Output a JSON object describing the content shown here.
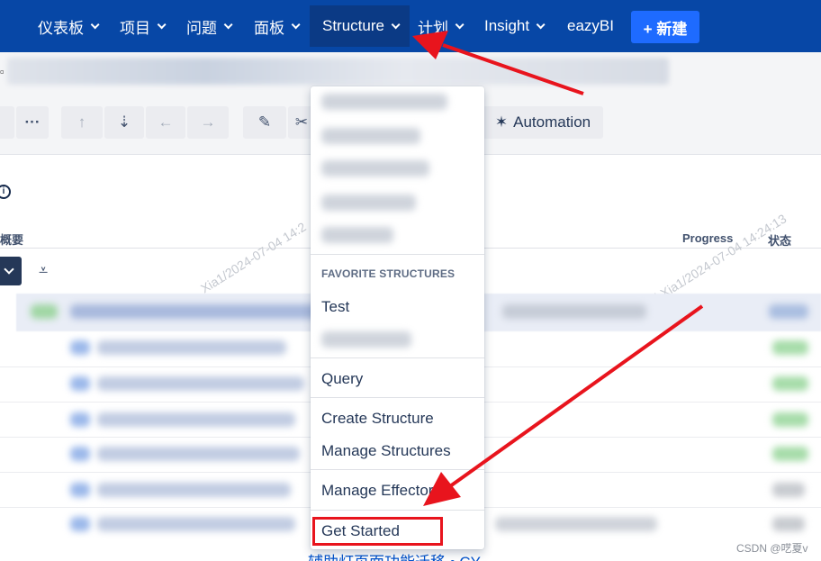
{
  "nav": {
    "items": [
      {
        "label": "仪表板",
        "chevron": true
      },
      {
        "label": "项目",
        "chevron": true
      },
      {
        "label": "问题",
        "chevron": true
      },
      {
        "label": "面板",
        "chevron": true
      },
      {
        "label": "Structure",
        "chevron": true,
        "active": true
      },
      {
        "label": "计划",
        "chevron": true
      },
      {
        "label": "Insight",
        "chevron": true
      },
      {
        "label": "eazyBI",
        "chevron": false
      }
    ],
    "create_label": "+ 新建"
  },
  "toolbar": {
    "more_label": "···",
    "automation_label": "Automation"
  },
  "table": {
    "summary_header": "概要",
    "progress_header": "Progress",
    "status_header": "状态"
  },
  "watermark": {
    "left": "Xia1/2024-07-04 14:2",
    "right": "i Xia1/2024-07-04 14:24:13"
  },
  "menu": {
    "favorites_heading": "FAVORITE STRUCTURES",
    "favorite_item": "Test",
    "query": "Query",
    "create_structure": "Create Structure",
    "manage_structures": "Manage Structures",
    "manage_effectors": "Manage Effectors",
    "get_started": "Get Started"
  },
  "bottom_text": "辅助灯页面功能迁移 • CY",
  "footer": {
    "csdn": "CSDN @呓夏v"
  },
  "colors": {
    "nav_bg": "#0747a6",
    "create_btn": "#1e6bff",
    "annotation_red": "#e8141d"
  }
}
